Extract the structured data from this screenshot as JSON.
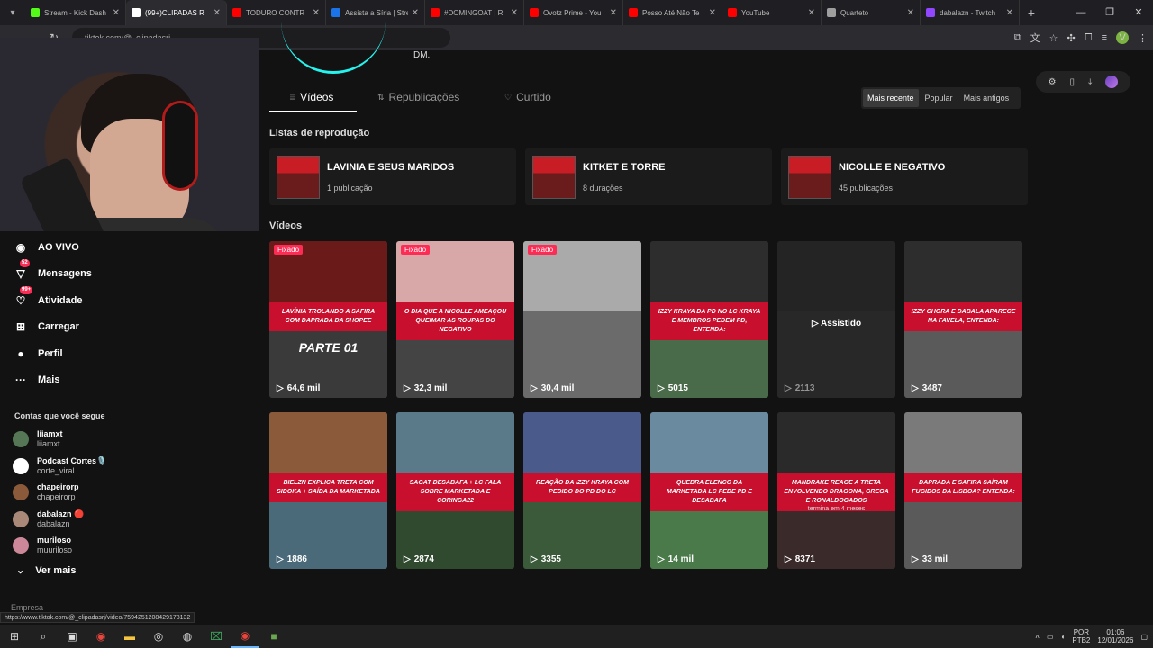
{
  "tabs": [
    {
      "title": "Stream - Kick Dash",
      "color": "#53fc18"
    },
    {
      "title": "(99+)CLIPADAS R",
      "color": "#ffffff",
      "active": true
    },
    {
      "title": "TODURO CONTR",
      "color": "#ff0000"
    },
    {
      "title": "Assista a Síria | Stre",
      "color": "#1a73e8"
    },
    {
      "title": "#DOMINGOAT | R",
      "color": "#ff0000"
    },
    {
      "title": "Ovotz Prime - You",
      "color": "#ff0000"
    },
    {
      "title": "Posso Até Não Te",
      "color": "#ff0000"
    },
    {
      "title": "YouTube",
      "color": "#ff0000"
    },
    {
      "title": "Quarteto",
      "color": "#9e9e9e"
    },
    {
      "title": "dabalazn - Twitch",
      "color": "#9146ff"
    }
  ],
  "url": "tiktok.com/@_clipadasrj",
  "profile_initial": "V",
  "header": {
    "dm": "DM."
  },
  "profile_tabs": [
    {
      "label": "Vídeos",
      "icon": "⦙⦙⦙"
    },
    {
      "label": "Republicações",
      "icon": "⇅"
    },
    {
      "label": "Curtido",
      "icon": "♡"
    }
  ],
  "sort": {
    "recent": "Mais recente",
    "popular": "Popular",
    "oldest": "Mais antigos"
  },
  "playlists_title": "Listas de reprodução",
  "playlists": [
    {
      "title": "LAVINIA E SEUS MARIDOS",
      "count": "1 publicação"
    },
    {
      "title": "KITKET E TORRE",
      "count": "8 durações"
    },
    {
      "title": "NICOLLE E NEGATIVO",
      "count": "45 publicações"
    }
  ],
  "videos_title": "Vídeos",
  "pinned_label": "Fixado",
  "watched_label": "Assistido",
  "videos": [
    {
      "caption": "Lavínia trolando a Safira com daprada da Shopee",
      "extra": "PARTE 01",
      "views": "64,6 mil",
      "pinned": true,
      "top": "#6b1a1a",
      "bot": "#3a3a3a"
    },
    {
      "caption": "O dia que a Nicolle ameaçou queimar as roupas do negativo",
      "views": "32,3 mil",
      "pinned": true,
      "top": "#d8a8a8",
      "bot": "#444"
    },
    {
      "caption": "",
      "views": "30,4 mil",
      "pinned": true,
      "top": "#aaaaaa",
      "bot": "#6b6b6b"
    },
    {
      "caption": "Izzy Kraya da PD no LC Kraya e membros pedem PD, entenda:",
      "views": "5015",
      "top": "#2d2d2d",
      "bot": "#4a6b4a"
    },
    {
      "caption": "",
      "views": "2113",
      "dim": true,
      "watched": true,
      "top": "#333",
      "bot": "#3a3a3a"
    },
    {
      "caption": "Izzy chora e dabala aparece na favela, entenda:",
      "views": "3487",
      "top": "#2d2d2d",
      "bot": "#5a5a5a"
    },
    {
      "caption": "Bielzn explica treta com Sidoka + saída da Marketada",
      "views": "1886",
      "top": "#8a5a3a",
      "bot": "#4a6a7a"
    },
    {
      "caption": "Sagat desabafa + LC fala sobre Marketada e Coringa22",
      "views": "2874",
      "top": "#5a7a8a",
      "bot": "#2f4a2f"
    },
    {
      "caption": "Reação da Izzy Kraya com pedido do PD do LC",
      "views": "3355",
      "top": "#4a5a8a",
      "bot": "#3a5a3a"
    },
    {
      "caption": "Quebra elenco da Marketada LC pede PD e desabafa",
      "views": "14 mil",
      "top": "#6a8aa0",
      "bot": "#4a7a4a"
    },
    {
      "caption": "Mandrake reage a treta envolvendo Dragona, Grega e Ronaldogados",
      "sub_note": "termina em 4 meses",
      "views": "8371",
      "top": "#2a2a2a",
      "bot": "#3a2a2a"
    },
    {
      "caption": "Daprada e Safira saíram fugidos da Lisboa? Entenda:",
      "views": "33 mil",
      "top": "#7a7a7a",
      "bot": "#5a5a5a"
    }
  ],
  "sidebar": {
    "items": [
      {
        "label": "AO VIVO",
        "icon": "◉"
      },
      {
        "label": "Mensagens",
        "icon": "▽",
        "badge": "52"
      },
      {
        "label": "Atividade",
        "icon": "♡",
        "badge": "99+"
      },
      {
        "label": "Carregar",
        "icon": "⊞"
      },
      {
        "label": "Perfil",
        "icon": "●"
      },
      {
        "label": "Mais",
        "icon": "···"
      }
    ],
    "following_title": "Contas que você segue",
    "accounts": [
      {
        "name": "liiamxt",
        "sub": "liiamxt",
        "color": "#557755"
      },
      {
        "name": "Podcast Cortes🎙️",
        "sub": "corte_viral",
        "color": "#ffffff"
      },
      {
        "name": "chapeirorp",
        "sub": "chapeirorp",
        "color": "#8a5a3a"
      },
      {
        "name": "dabalazn 🔴",
        "sub": "dabalazn",
        "color": "#aa8877"
      },
      {
        "name": "muriloso",
        "sub": "muuriloso",
        "color": "#cc8899"
      }
    ],
    "see_more": "Ver mais",
    "empresa": "Empresa"
  },
  "status_url": "https://www.tiktok.com/@_clipadasrj/video/7594251208429178132",
  "tray": {
    "lang1": "POR",
    "lang2": "PTB2",
    "time": "01:06",
    "date": "12/01/2026"
  }
}
